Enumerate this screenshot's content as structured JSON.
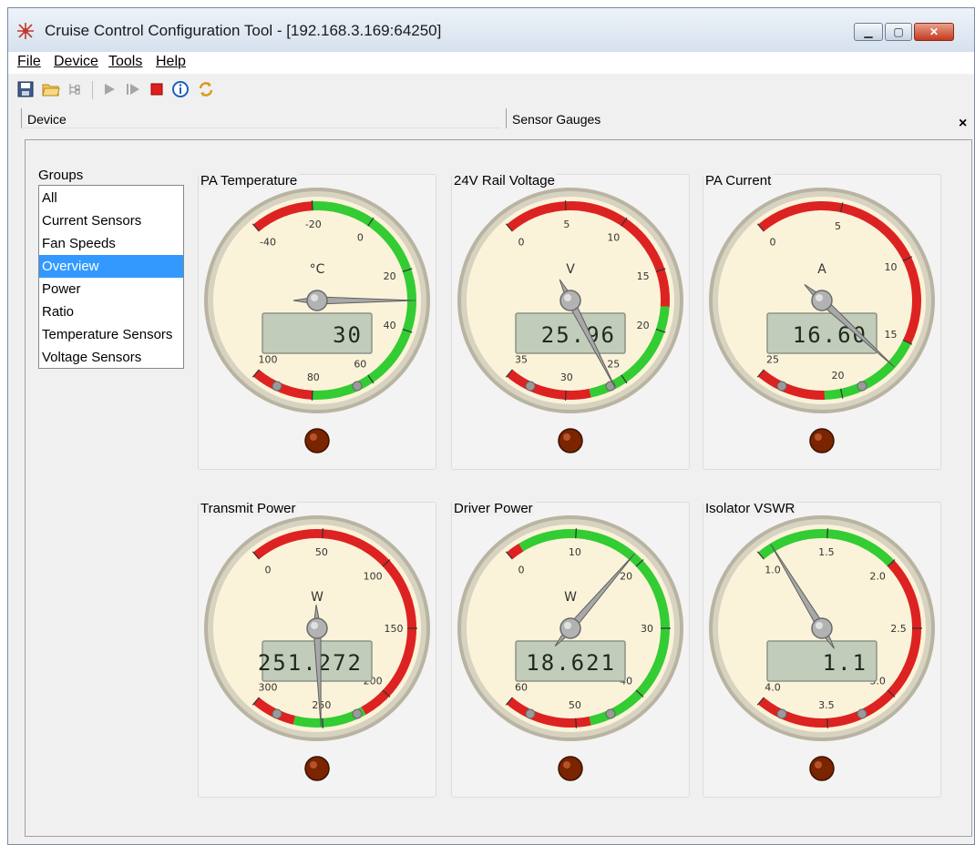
{
  "window": {
    "title": "Cruise Control Configuration Tool - [192.168.3.169:64250]",
    "min_icon": "minimize-icon",
    "max_icon": "maximize-icon",
    "close_icon": "close-icon"
  },
  "menu": [
    "File",
    "Device",
    "Tools",
    "Help"
  ],
  "toolbar": [
    "save-icon",
    "open-folder-icon",
    "tree-icon",
    "play-icon",
    "step-icon",
    "stop-icon",
    "info-icon",
    "refresh-icon"
  ],
  "tabs": {
    "device": "Device",
    "sensor": "Sensor Gauges",
    "close": "×"
  },
  "groups": {
    "label": "Groups",
    "items": [
      "All",
      "Current Sensors",
      "Fan Speeds",
      "Overview",
      "Power",
      "Ratio",
      "Temperature Sensors",
      "Voltage Sensors"
    ],
    "selected": "Overview"
  },
  "colors": {
    "green": "#33cc33",
    "red": "#dd2222",
    "lcd": "#c2ccba",
    "face": "#fbf3d9",
    "led": "#7a2400",
    "selection": "#3399ff"
  },
  "gauges": [
    {
      "title": "PA Temperature",
      "unit": "°C",
      "display": "30",
      "value": 30,
      "min": -40,
      "max": 100,
      "ticks": [
        "-40",
        "-20",
        "0",
        "20",
        "40",
        "60",
        "80",
        "100"
      ],
      "zones": [
        [
          -40,
          -20,
          "red"
        ],
        [
          -20,
          80,
          "green"
        ],
        [
          80,
          100,
          "red"
        ]
      ]
    },
    {
      "title": "24V Rail Voltage",
      "unit": "V",
      "display": "25.96",
      "value": 25.96,
      "min": 0,
      "max": 35,
      "ticks": [
        "0",
        "5",
        "10",
        "15",
        "20",
        "25",
        "30",
        "35"
      ],
      "zones": [
        [
          0,
          18,
          "red"
        ],
        [
          18,
          28,
          "green"
        ],
        [
          28,
          35,
          "red"
        ]
      ]
    },
    {
      "title": "PA Current",
      "unit": "A",
      "display": "16.60",
      "value": 16.6,
      "min": 0,
      "max": 25,
      "ticks": [
        "0",
        "5",
        "10",
        "15",
        "20",
        "25"
      ],
      "zones": [
        [
          0,
          15,
          "red"
        ],
        [
          15,
          21,
          "green"
        ],
        [
          21,
          25,
          "red"
        ]
      ]
    },
    {
      "title": "Transmit Power",
      "unit": "W",
      "display": "251.272",
      "value": 251.272,
      "min": 0,
      "max": 300,
      "ticks": [
        "0",
        "50",
        "100",
        "150",
        "200",
        "250",
        "300"
      ],
      "zones": [
        [
          0,
          220,
          "red"
        ],
        [
          220,
          270,
          "green"
        ],
        [
          270,
          300,
          "red"
        ]
      ]
    },
    {
      "title": "Driver Power",
      "unit": "W",
      "display": "18.621",
      "value": 18.621,
      "min": 0,
      "max": 60,
      "ticks": [
        "0",
        "10",
        "20",
        "30",
        "40",
        "50",
        "60"
      ],
      "zones": [
        [
          0,
          2,
          "red"
        ],
        [
          2,
          48,
          "green"
        ],
        [
          48,
          60,
          "red"
        ]
      ]
    },
    {
      "title": "Isolator VSWR",
      "unit": "",
      "display": "1.1",
      "value": 1.1,
      "min": 1.0,
      "max": 4.0,
      "ticks": [
        "1.0",
        "1.5",
        "2.0",
        "2.5",
        "3.0",
        "3.5",
        "4.0"
      ],
      "zones": [
        [
          1.0,
          2.0,
          "green"
        ],
        [
          2.0,
          4.0,
          "red"
        ]
      ]
    }
  ]
}
